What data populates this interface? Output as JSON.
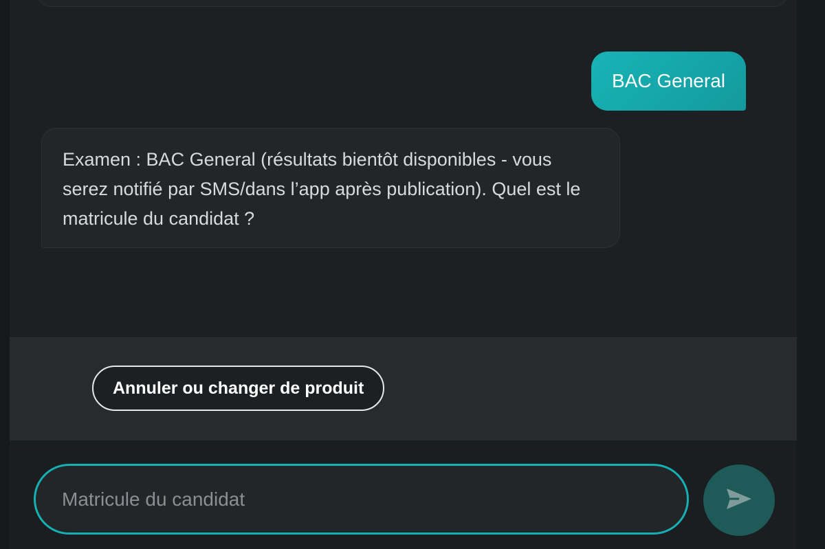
{
  "messages": {
    "user": "BAC General",
    "bot": "Examen : BAC General (résultats bientôt disponibles - vous serez notifié par SMS/dans l’app après publication). Quel est le matricule du candidat ?"
  },
  "actions": {
    "cancel_label": "Annuler ou changer de produit"
  },
  "composer": {
    "placeholder": "Matricule du candidat",
    "value": ""
  },
  "icons": {
    "send": "send-icon"
  },
  "colors": {
    "accent": "#17b0b2",
    "user_bubble": "#18b4b6",
    "send_button": "#1d5a58",
    "background": "#1d2022"
  }
}
